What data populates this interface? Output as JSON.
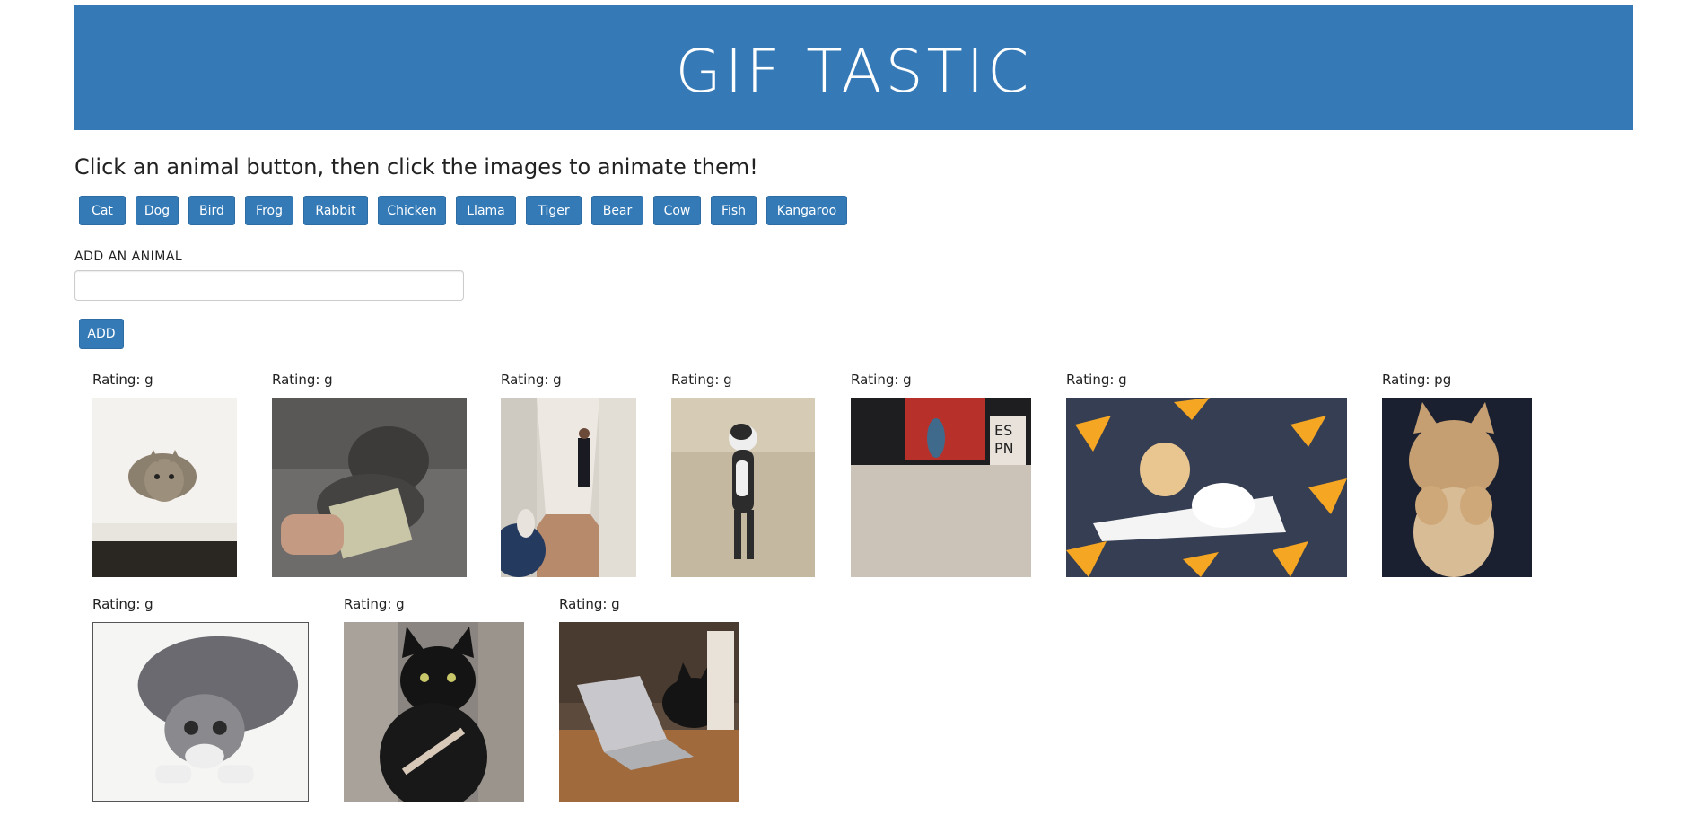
{
  "header": {
    "title": "GIF TASTIC"
  },
  "instructions": "Click an animal button, then click the images to animate them!",
  "animal_buttons": [
    "Cat",
    "Dog",
    "Bird",
    "Frog",
    "Rabbit",
    "Chicken",
    "Llama",
    "Tiger",
    "Bear",
    "Cow",
    "Fish",
    "Kangaroo"
  ],
  "form": {
    "label": "ADD AN ANIMAL",
    "input_value": "",
    "add_label": "ADD"
  },
  "gifs": [
    {
      "rating": "Rating: g",
      "subject": "tabby cat crouching on white bench"
    },
    {
      "rating": "Rating: g",
      "subject": "grey cat grabbing dollar bills"
    },
    {
      "rating": "Rating: g",
      "subject": "cat in hallway with man"
    },
    {
      "rating": "Rating: g",
      "subject": "cat standing upright on carpet"
    },
    {
      "rating": "Rating: g",
      "subject": "room with red vase and ESPN sign"
    },
    {
      "rating": "Rating: g",
      "subject": "cartoon cats on flying carpet with pizza"
    },
    {
      "rating": "Rating: pg",
      "subject": "orange kitten with paws raised"
    },
    {
      "rating": "Rating: g",
      "subject": "tabby cat crouching ready to pounce"
    },
    {
      "rating": "Rating: g",
      "subject": "black cat holding nail file"
    },
    {
      "rating": "Rating: g",
      "subject": "black cat on laptop"
    }
  ],
  "colors": {
    "brand": "#357ab7",
    "button": "#337ab7",
    "button_text": "#ffffff"
  }
}
